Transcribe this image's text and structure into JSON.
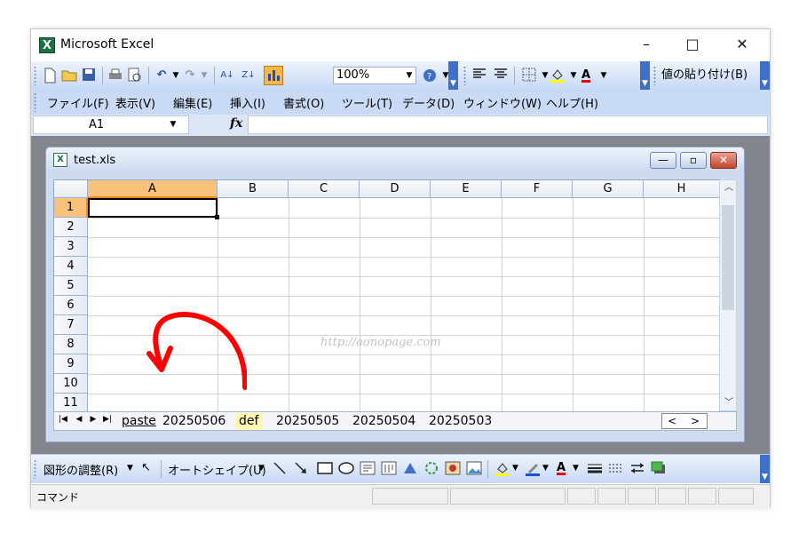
{
  "app": {
    "title": "Microsoft Excel",
    "icon": "excel-app-icon"
  },
  "window_controls": {
    "minimize": "–",
    "maximize": "□",
    "close": "✕"
  },
  "toolbar": {
    "zoom_value": "100%",
    "paste_values_label": "値の貼り付け(B)",
    "font_color_letter": "A"
  },
  "menu": {
    "items": [
      "ファイル(F)",
      "表示(V)",
      "編集(E)",
      "挿入(I)",
      "書式(O)",
      "ツール(T)",
      "データ(D)",
      "ウィンドウ(W)",
      "ヘルプ(H)"
    ]
  },
  "formula_bar": {
    "name_box": "A1",
    "fx_label": "fx",
    "formula": ""
  },
  "workbook": {
    "title": "test.xls"
  },
  "grid": {
    "columns": [
      "A",
      "B",
      "C",
      "D",
      "E",
      "F",
      "G",
      "H"
    ],
    "rows": [
      "1",
      "2",
      "3",
      "4",
      "5",
      "6",
      "7",
      "8",
      "9",
      "10",
      "11"
    ],
    "selected_cell": "A1"
  },
  "watermark": "http://aonopage.com",
  "sheet_tabs": [
    "paste",
    "20250506",
    "def",
    "20250505",
    "20250504",
    "20250503"
  ],
  "active_sheet": "paste",
  "highlighted_sheet": "def",
  "annotation": {
    "color": "#ff0000",
    "description_icon": "curved-arrow-annotation"
  },
  "drawing_toolbar": {
    "draw_label": "図形の調整(R)",
    "autoshape_label": "オートシェイプ(U)"
  },
  "status": {
    "text": "コマンド"
  },
  "colors": {
    "toolbar_blue": "#c9daf5",
    "selected_header": "#f8c27a",
    "workspace": "#82868c",
    "highlight_tab": "#fff7b0"
  }
}
